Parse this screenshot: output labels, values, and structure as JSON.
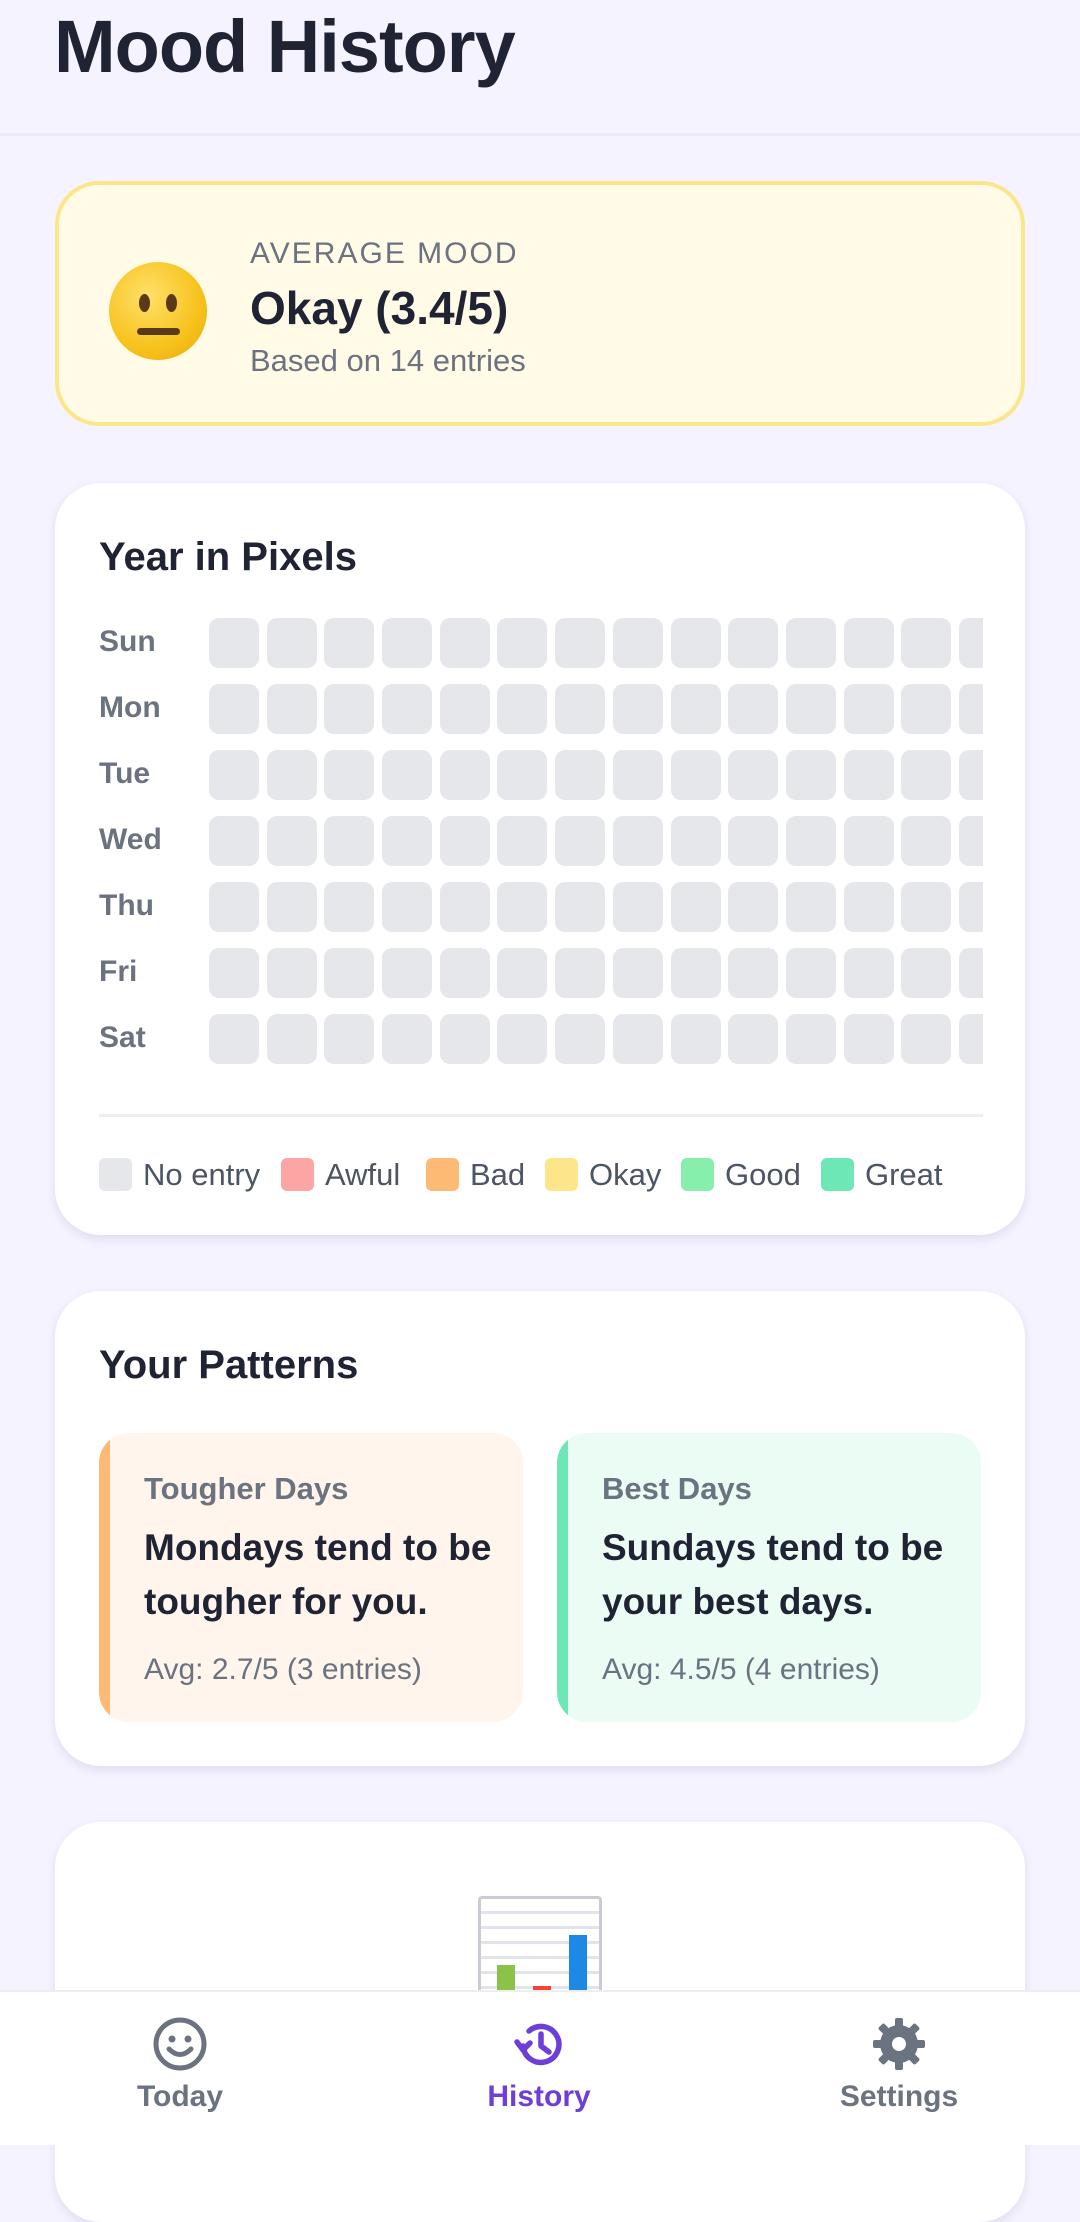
{
  "header": {
    "title": "Mood History"
  },
  "average": {
    "label": "AVERAGE MOOD",
    "value": "Okay (3.4/5)",
    "sub": "Based on 14 entries",
    "icon": "neutral-face-emoji"
  },
  "pixels": {
    "title": "Year in Pixels",
    "days": [
      "Sun",
      "Mon",
      "Tue",
      "Wed",
      "Thu",
      "Fri",
      "Sat"
    ],
    "legend": [
      {
        "label": "No entry",
        "color": "#e5e7eb"
      },
      {
        "label": "Awful",
        "color": "#fca5a5"
      },
      {
        "label": "Bad",
        "color": "#fdba74"
      },
      {
        "label": "Okay",
        "color": "#fde68a"
      },
      {
        "label": "Good",
        "color": "#86efac"
      },
      {
        "label": "Great",
        "color": "#6ee7b7"
      }
    ]
  },
  "patterns": {
    "title": "Your Patterns",
    "tough": {
      "tag": "Tougher Days",
      "text": "Mondays tend to be tougher for you.",
      "avg": "Avg: 2.7/5 (3 entries)"
    },
    "best": {
      "tag": "Best Days",
      "text": "Sundays tend to be your best days.",
      "avg": "Avg: 4.5/5 (4 entries)"
    }
  },
  "chart_card": {
    "icon": "bar-chart-icon"
  },
  "nav": {
    "items": [
      {
        "label": "Today",
        "icon": "smiley-icon",
        "active": false
      },
      {
        "label": "History",
        "icon": "history-icon",
        "active": true
      },
      {
        "label": "Settings",
        "icon": "gear-icon",
        "active": false
      }
    ]
  },
  "colors": {
    "accent": "#6d3fd6",
    "empty_cell": "#e5e7eb"
  }
}
